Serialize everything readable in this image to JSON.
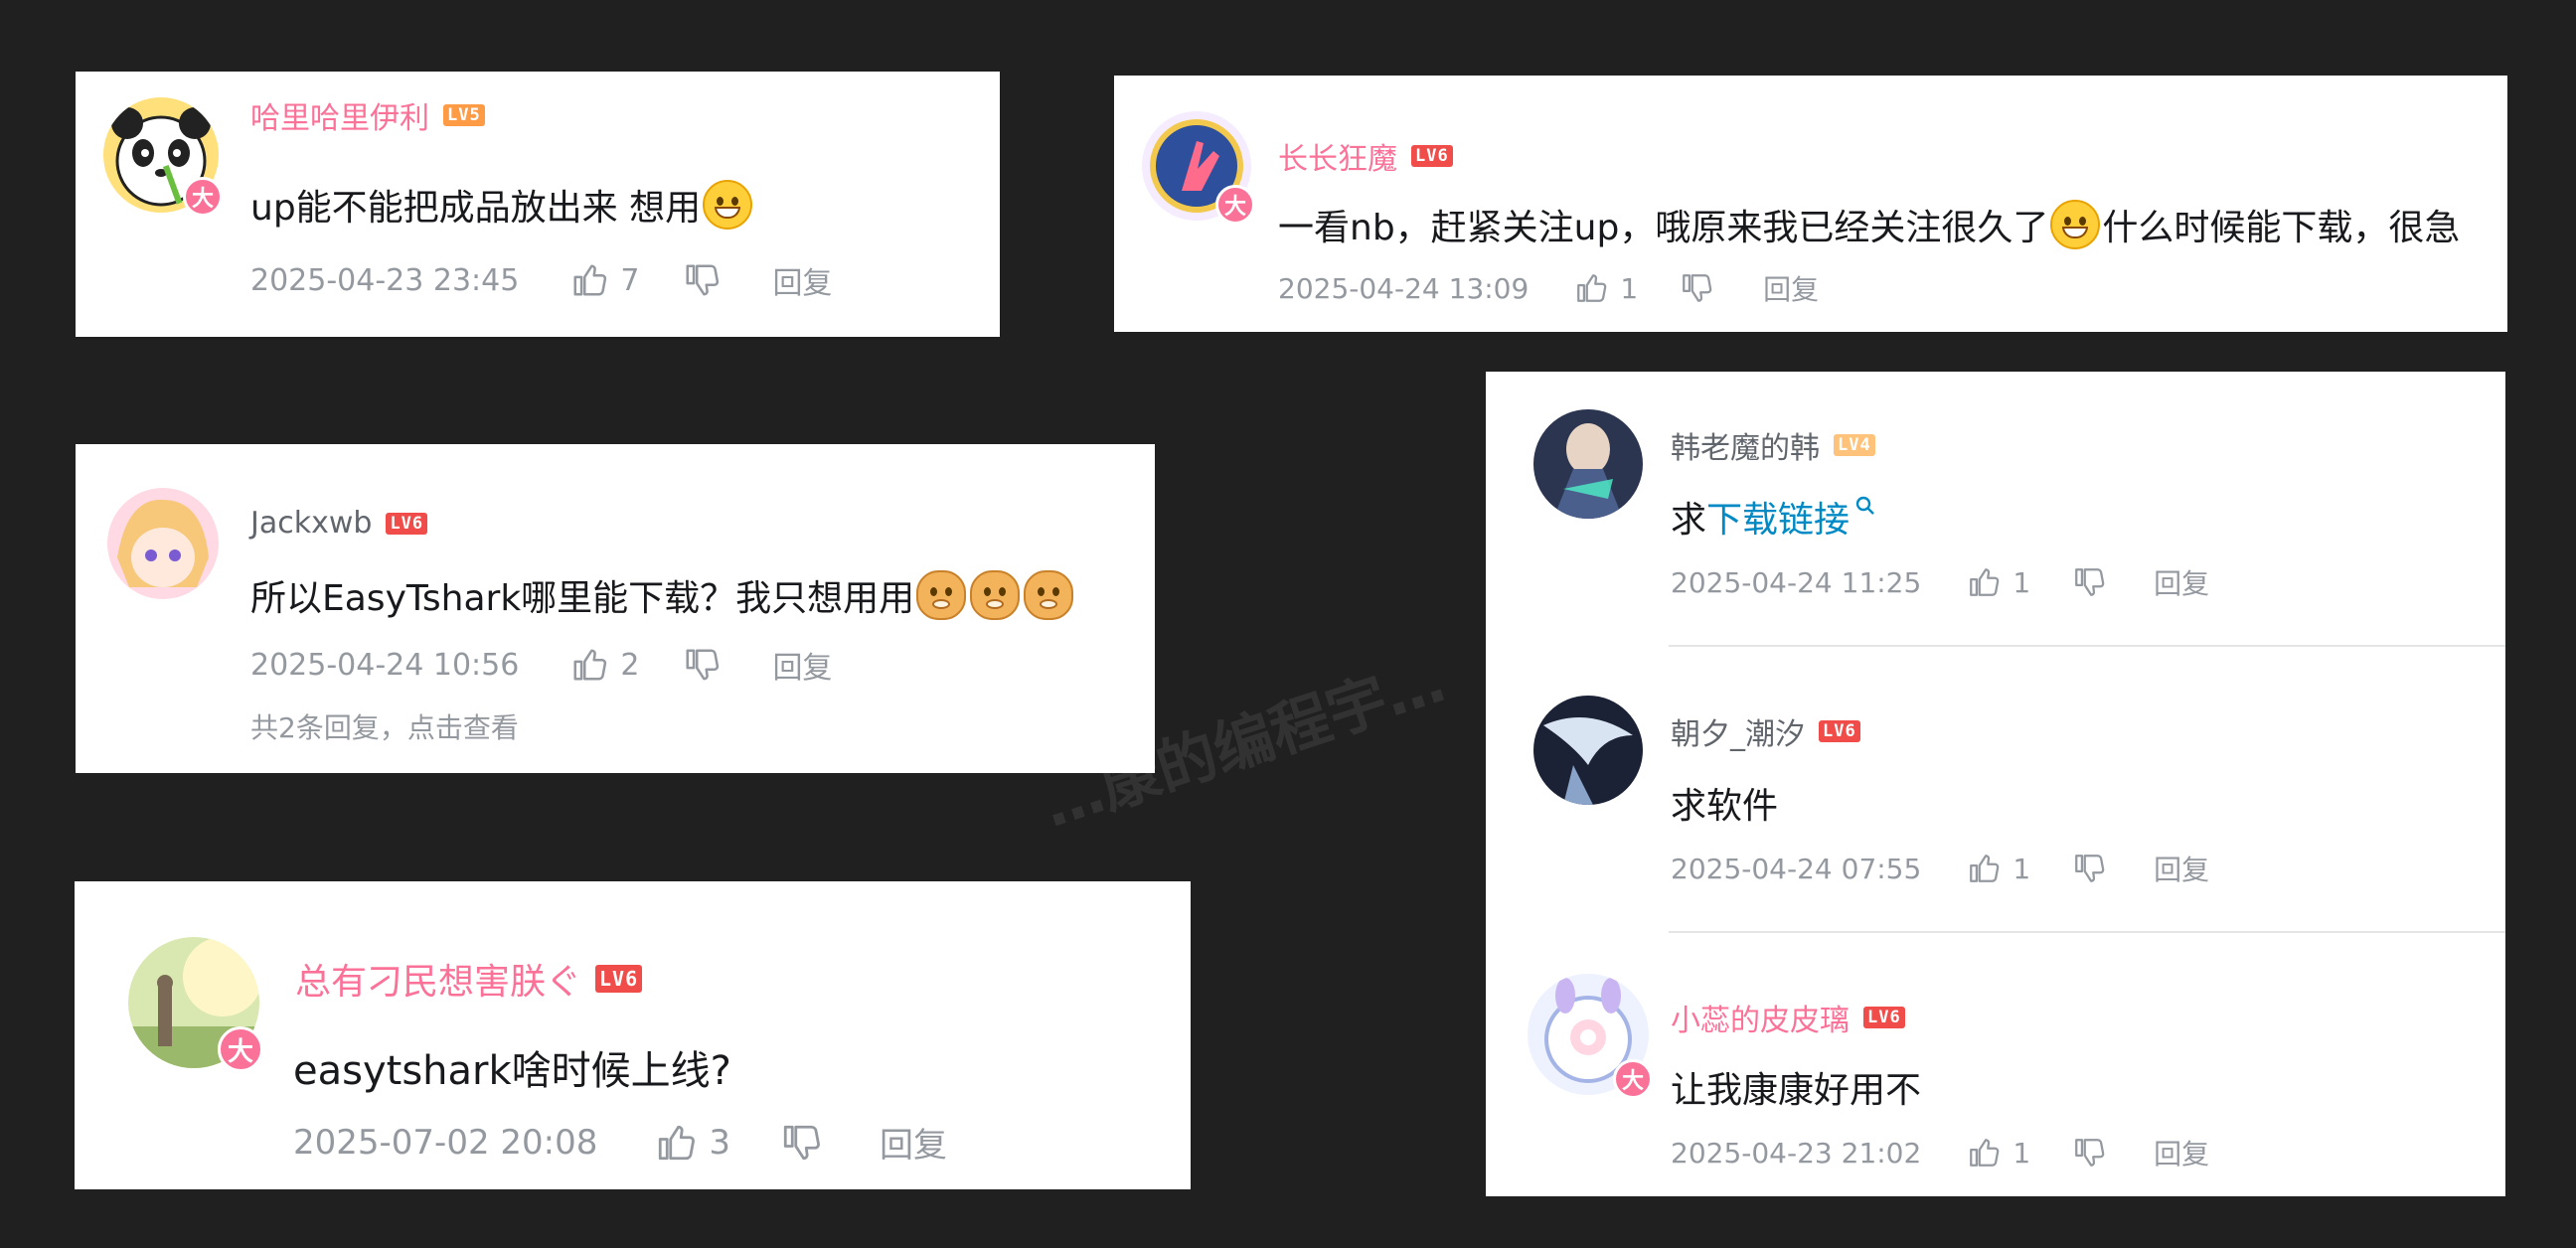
{
  "watermark": "…康的编程宇…",
  "comments": [
    {
      "id": "c1",
      "username": "哈里哈里伊利",
      "level": "LV5",
      "text": "up能不能把成品放出来 想用",
      "time": "2025-04-23 23:45",
      "likes": "7",
      "reply_label": "回复",
      "vip_badge": "大"
    },
    {
      "id": "c2",
      "username": "长长狂魔",
      "level": "LV6",
      "text_before": "一看nb，赶紧关注up，哦原来我已经关注很久了",
      "text_after": "什么时候能下载，很急",
      "time": "2025-04-24 13:09",
      "likes": "1",
      "reply_label": "回复",
      "vip_badge": "大"
    },
    {
      "id": "c3",
      "username": "Jackxwb",
      "level": "LV6",
      "text": "所以EasyTshark哪里能下载？我只想用用",
      "time": "2025-04-24 10:56",
      "likes": "2",
      "reply_label": "回复",
      "replies_summary": "共2条回复，点击查看"
    },
    {
      "id": "c4",
      "username": "总有刁民想害朕ぐ",
      "level": "LV6",
      "text": "easytshark啥时候上线?",
      "time": "2025-07-02 20:08",
      "likes": "3",
      "reply_label": "回复",
      "vip_badge": "大"
    },
    {
      "id": "c5",
      "username": "韩老魔的韩",
      "level": "LV4",
      "text_before": "求",
      "text_link": "下载链接",
      "time": "2025-04-24 11:25",
      "likes": "1",
      "reply_label": "回复"
    },
    {
      "id": "c6",
      "username": "朝夕_潮汐",
      "level": "LV6",
      "text": "求软件",
      "time": "2025-04-24 07:55",
      "likes": "1",
      "reply_label": "回复"
    },
    {
      "id": "c7",
      "username": "小蕊的皮皮璃",
      "level": "LV6",
      "text": "让我康康好用不",
      "time": "2025-04-23 21:02",
      "likes": "1",
      "reply_label": "回复",
      "vip_badge": "大"
    }
  ],
  "colors": {
    "background": "#202020",
    "vip_name": "#fb7299",
    "normal_name": "#61666d",
    "meta": "#9499a0",
    "link": "#008ac5"
  }
}
